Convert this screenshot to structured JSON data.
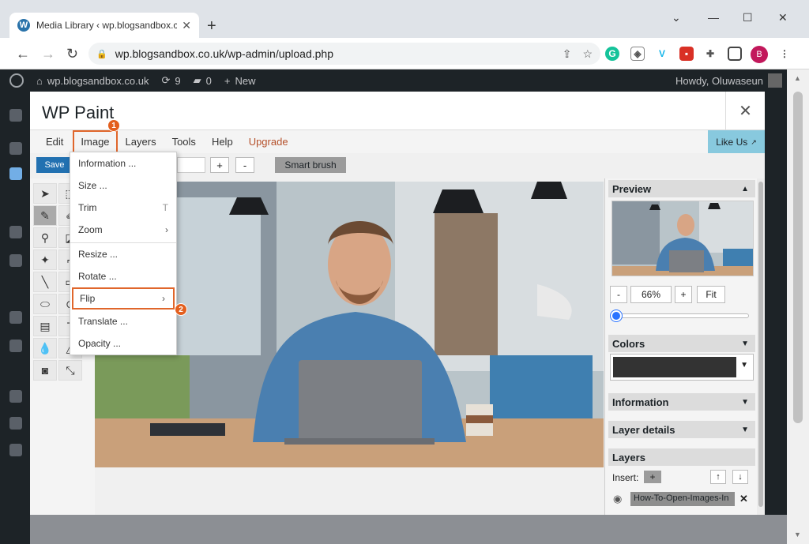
{
  "browser": {
    "tab_title": "Media Library ‹ wp.blogsandbox.co.uk",
    "url": "wp.blogsandbox.co.uk/wp-admin/upload.php",
    "profile_initial": "B"
  },
  "adminbar": {
    "site": "wp.blogsandbox.co.uk",
    "updates": "9",
    "comments": "0",
    "new": "New",
    "howdy": "Howdy, Oluwaseun"
  },
  "modal": {
    "title": "WP Paint",
    "menu": {
      "edit": "Edit",
      "image": "Image",
      "layers": "Layers",
      "tools": "Tools",
      "help": "Help",
      "upgrade": "Upgrade",
      "like_us": "Like Us"
    },
    "toolbar": {
      "save": "Save",
      "plus": "+",
      "minus": "-",
      "smart_brush": "Smart brush"
    },
    "image_menu": {
      "information": "Information ...",
      "size": "Size ...",
      "trim": "Trim",
      "trim_shortcut": "T",
      "zoom": "Zoom",
      "resize": "Resize ...",
      "rotate": "Rotate ...",
      "flip": "Flip",
      "translate": "Translate ...",
      "opacity": "Opacity ..."
    },
    "badges": {
      "one": "1",
      "two": "2"
    },
    "right_panel": {
      "preview": "Preview",
      "zoom_minus": "-",
      "zoom_value": "66%",
      "zoom_plus": "+",
      "zoom_fit": "Fit",
      "zoom_slider_level": 0.0,
      "colors": "Colors",
      "color_value": "#333333",
      "information": "Information",
      "layer_details": "Layer details",
      "layers": "Layers",
      "insert": "Insert:",
      "insert_btn": "+",
      "up": "↑",
      "down": "↓",
      "layer_name": "How-To-Open-Images-In",
      "delete": "✕"
    }
  },
  "colors": {
    "accent_orange": "#e0662b",
    "wp_blue": "#2271b1",
    "like_us_bg": "#88c9de"
  }
}
